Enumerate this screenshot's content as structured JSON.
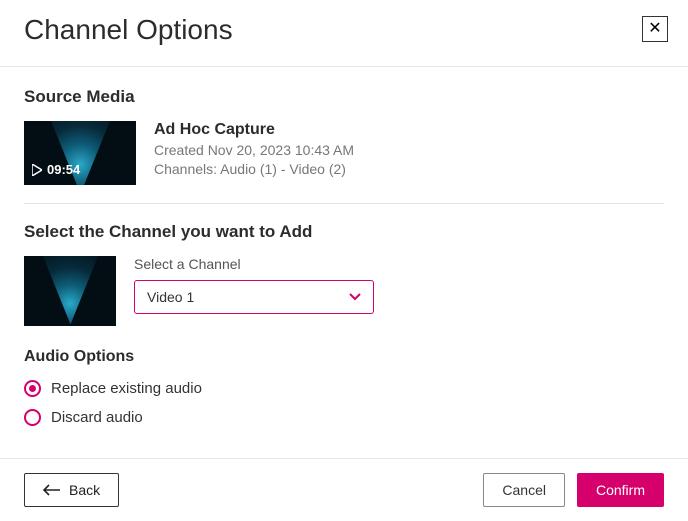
{
  "dialog": {
    "title": "Channel Options"
  },
  "source": {
    "heading": "Source Media",
    "duration": "09:54",
    "title": "Ad Hoc Capture",
    "created": "Created Nov 20, 2023 10:43 AM",
    "channels": "Channels: Audio (1) - Video (2)"
  },
  "select": {
    "heading": "Select the Channel you want to Add",
    "label": "Select a Channel",
    "value": "Video 1"
  },
  "audio": {
    "heading": "Audio Options",
    "options": [
      {
        "label": "Replace existing audio",
        "checked": true
      },
      {
        "label": "Discard audio",
        "checked": false
      }
    ]
  },
  "footer": {
    "back": "Back",
    "cancel": "Cancel",
    "confirm": "Confirm"
  }
}
